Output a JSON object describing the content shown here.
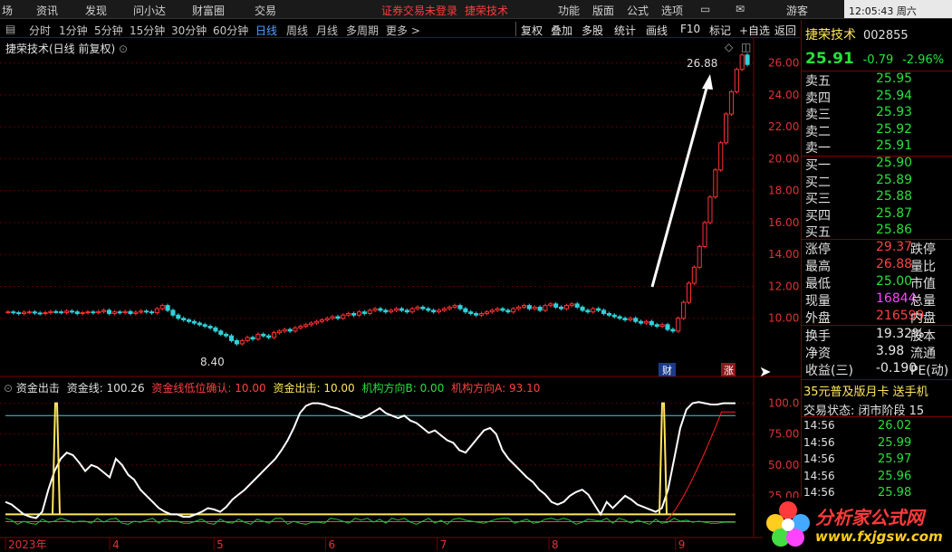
{
  "menu": [
    "场",
    "资讯",
    "发现",
    "问小达",
    "财富圈",
    "交易"
  ],
  "menu_warn": "证券交易未登录",
  "menu_stock": "捷荣技术",
  "menu_right": [
    "功能",
    "版面",
    "公式",
    "选项"
  ],
  "tour": "游客",
  "clock": "12:05:43 周六",
  "periods": [
    "分时",
    "1分钟",
    "5分钟",
    "15分钟",
    "30分钟",
    "60分钟",
    "日线",
    "周线",
    "月线",
    "多周期",
    "更多 >"
  ],
  "active_period": "日线",
  "toolbar": [
    "复权",
    "叠加",
    "多股",
    "统计",
    "画线",
    "F10",
    "标记",
    "+自选",
    "返回"
  ],
  "main_title": "捷荣技术(日线 前复权)",
  "high_label": "26.88",
  "low_label": "8.40",
  "marker_cai": "财",
  "marker_zhang": "涨",
  "indicator": {
    "name": "资金出击",
    "line1": "资金线: 100.26",
    "line2": "资金线低位确认: 10.00",
    "line3": "资金出击: 10.00",
    "line4": "机构方向B: 0.00",
    "line5": "机构方向A: 93.10"
  },
  "x_labels": [
    "2023年",
    "4",
    "5",
    "6",
    "7",
    "8",
    "9"
  ],
  "price_axis": [
    "26.00",
    "24.00",
    "22.00",
    "20.00",
    "18.00",
    "16.00",
    "14.00",
    "12.00",
    "10.00"
  ],
  "ind_axis": [
    "100.0",
    "75.00",
    "50.00",
    "25.00"
  ],
  "colors": {
    "up": "#ff3232",
    "down": "#30d0d8",
    "ma": "#ffffff",
    "grid": "#5a0000"
  },
  "stock": {
    "name": "捷荣技术",
    "code": "002855",
    "price": "25.91",
    "change": "-0.79",
    "pct": "-2.96%"
  },
  "asks": [
    {
      "label": "卖五",
      "price": "25.95"
    },
    {
      "label": "卖四",
      "price": "25.94"
    },
    {
      "label": "卖三",
      "price": "25.93"
    },
    {
      "label": "卖二",
      "price": "25.92"
    },
    {
      "label": "卖一",
      "price": "25.91"
    }
  ],
  "bids": [
    {
      "label": "买一",
      "price": "25.90"
    },
    {
      "label": "买二",
      "price": "25.89"
    },
    {
      "label": "买三",
      "price": "25.88"
    },
    {
      "label": "买四",
      "price": "25.87"
    },
    {
      "label": "买五",
      "price": "25.86"
    }
  ],
  "stats": [
    {
      "l": "涨停",
      "v": "29.37",
      "c": "red",
      "l2": "跌停"
    },
    {
      "l": "最高",
      "v": "26.88",
      "c": "red",
      "l2": "量比"
    },
    {
      "l": "最低",
      "v": "25.00",
      "c": "",
      "l2": "市值"
    },
    {
      "l": "现量",
      "v": "16844",
      "c": "mag",
      "l2": "总量"
    },
    {
      "l": "外盘",
      "v": "216599",
      "c": "red",
      "l2": "内盘"
    }
  ],
  "stats2": [
    {
      "l": "换手",
      "v": "19.32%",
      "c": "wht",
      "l2": "股本"
    },
    {
      "l": "净资",
      "v": "3.98",
      "c": "wht",
      "l2": "流通"
    },
    {
      "l": "收益(三)",
      "v": "-0.190",
      "c": "wht",
      "l2": "PE(动)"
    }
  ],
  "ad": "35元普及版月卡 送手机",
  "trade_status": "交易状态: 闭市阶段 15",
  "ticks": [
    {
      "t": "14:56",
      "p": "26.02"
    },
    {
      "t": "14:56",
      "p": "25.99"
    },
    {
      "t": "14:56",
      "p": "25.97"
    },
    {
      "t": "14:56",
      "p": "25.96"
    },
    {
      "t": "14:56",
      "p": "25.98"
    }
  ],
  "logo_text": "分析家公式网",
  "logo_url": "www.fxjgsw.com",
  "chart_data": {
    "type": "candlestick",
    "ylim": [
      8.0,
      27.0
    ],
    "closes": [
      10.4,
      10.35,
      10.3,
      10.38,
      10.4,
      10.33,
      10.3,
      10.35,
      10.42,
      10.4,
      10.36,
      10.45,
      10.4,
      10.3,
      10.35,
      10.4,
      10.35,
      10.42,
      10.5,
      10.3,
      10.4,
      10.35,
      10.42,
      10.3,
      10.38,
      10.45,
      10.4,
      10.35,
      10.6,
      10.8,
      10.5,
      10.2,
      10.0,
      9.9,
      9.8,
      9.7,
      9.6,
      9.5,
      9.4,
      9.2,
      9.0,
      8.9,
      8.6,
      8.4,
      8.6,
      8.8,
      8.7,
      9.0,
      8.9,
      8.8,
      9.1,
      9.2,
      9.3,
      9.2,
      9.4,
      9.5,
      9.6,
      9.7,
      9.8,
      9.9,
      10.0,
      10.1,
      10.0,
      10.2,
      10.3,
      10.2,
      10.4,
      10.3,
      10.5,
      10.6,
      10.5,
      10.4,
      10.5,
      10.6,
      10.5,
      10.4,
      10.6,
      10.7,
      10.6,
      10.5,
      10.4,
      10.5,
      10.6,
      10.7,
      10.8,
      10.6,
      10.4,
      10.3,
      10.2,
      10.3,
      10.4,
      10.5,
      10.6,
      10.5,
      10.4,
      10.6,
      10.7,
      10.8,
      10.6,
      10.7,
      10.5,
      10.8,
      10.9,
      10.7,
      10.6,
      10.8,
      10.9,
      10.7,
      10.5,
      10.4,
      10.6,
      10.5,
      10.3,
      10.2,
      10.1,
      10.0,
      9.9,
      10.0,
      9.8,
      9.7,
      9.8,
      9.6,
      9.5,
      9.6,
      9.3,
      9.2,
      10.0,
      11.0,
      12.2,
      13.2,
      14.5,
      16.0,
      17.6,
      19.3,
      21.0,
      22.8,
      24.2,
      25.6,
      26.5,
      25.91
    ],
    "indicator_ylim": [
      0,
      110
    ],
    "fund_line": [
      20,
      18,
      14,
      10,
      8,
      7,
      12,
      30,
      45,
      55,
      60,
      58,
      52,
      45,
      50,
      48,
      44,
      40,
      55,
      50,
      42,
      38,
      30,
      25,
      20,
      15,
      12,
      10,
      10,
      8,
      8,
      10,
      12,
      15,
      14,
      12,
      16,
      22,
      26,
      30,
      35,
      40,
      45,
      50,
      55,
      62,
      70,
      80,
      92,
      98,
      100,
      100,
      99,
      97,
      96,
      94,
      92,
      90,
      88,
      90,
      93,
      96,
      92,
      90,
      88,
      90,
      86,
      84,
      80,
      76,
      78,
      74,
      70,
      68,
      62,
      60,
      66,
      72,
      78,
      80,
      75,
      62,
      55,
      50,
      45,
      40,
      36,
      30,
      26,
      20,
      18,
      20,
      25,
      28,
      30,
      26,
      18,
      10,
      20,
      15,
      20,
      25,
      22,
      18,
      16,
      14,
      12,
      15,
      30,
      55,
      80,
      95,
      100,
      101,
      100,
      99,
      99,
      100,
      100,
      100
    ]
  }
}
